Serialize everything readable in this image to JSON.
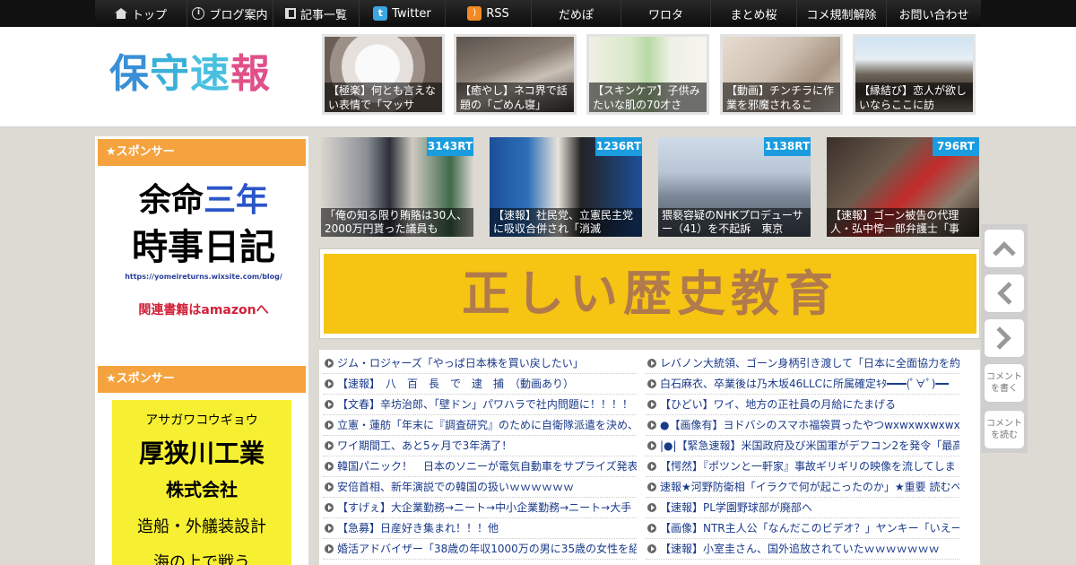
{
  "nav": {
    "items": [
      {
        "label": "トップ",
        "icon": "home-icon"
      },
      {
        "label": "ブログ案内",
        "icon": "info-icon"
      },
      {
        "label": "記事一覧",
        "icon": "list-icon"
      },
      {
        "label": "Twitter",
        "icon": "twitter-icon"
      },
      {
        "label": "RSS",
        "icon": "rss-icon"
      },
      {
        "label": "だめぽ"
      },
      {
        "label": "ワロタ"
      },
      {
        "label": "まとめ桜"
      },
      {
        "label": "コメ規制解除"
      },
      {
        "label": "お問い合わせ"
      }
    ]
  },
  "header": {
    "logo_text": "保守速報",
    "thumbs": [
      {
        "caption": "【極楽】何とも言えない表情で「マッサ"
      },
      {
        "caption": "【癒やし】ネコ界で話題の「ごめん寝」"
      },
      {
        "caption": "【スキンケア】子供みたいな肌の70才さ"
      },
      {
        "caption": "【動画】チンチラに作業を邪魔されるこ"
      },
      {
        "caption": "【縁結び】恋人が欲しいならここに訪"
      }
    ]
  },
  "sidebar": {
    "sponsor_label_1": "★スポンサー",
    "ad1": {
      "line1a": "余命",
      "line1b": "三年",
      "line2": "時事日記",
      "url": "https://yomeireturns.wixsite.com/blog/",
      "link": "関連書籍はamazonへ"
    },
    "sponsor_label_2": "★スポンサー",
    "ad2": {
      "kana": "アサガワコウギョウ",
      "name": "厚狭川工業",
      "corp": "株式会社",
      "desc": "造船・外艤装設計",
      "more": "海の上で戦う"
    }
  },
  "cards": [
    {
      "rt": "3143RT",
      "caption": "「俺の知る限り賄賂は30人、2000万円貰った議員も"
    },
    {
      "rt": "1236RT",
      "caption": "【速報】社民党、立憲民主党に吸収合併され「消滅"
    },
    {
      "rt": "1138RT",
      "caption": "猥褻容疑のNHKプロデューサー（41）を不起訴　東京"
    },
    {
      "rt": "796RT",
      "caption": "【速報】ゴーン被告の代理人・弘中惇一郎弁護士「事"
    }
  ],
  "banner": {
    "text": "正しい歴史教育"
  },
  "list": {
    "left": [
      "ジム・ロジャーズ「やっぱ日本株を買い戻したい」",
      "【速報】　八　百　長　で　逮　捕　（動画あり）",
      "【文春】辛坊治郎、「壁ドン」パワハラで社内問題に！！！！",
      "立憲・蓮舫「年末に『調査研究』のために自衛隊派遣を決め、",
      "ワイ期間工、あと5ヶ月で3年満了！",
      "韓国パニック！　日本のソニーが電気自動車をサプライズ発表",
      "安倍首相、新年演説での韓国の扱いｗｗｗｗｗｗ",
      "【すげぇ】大企業勤務→ニート→中小企業勤務→ニート→大手",
      "【急募】日産好き集まれ！！！他",
      "婚活アドバイザー「38歳の年収1000万の男に35歳の女性を紹介"
    ],
    "right": [
      "レバノン大統領、ゴーン身柄引き渡して「日本に全面協力を約",
      "白石麻衣、卒業後は乃木坂46LLCに所属確定ｷﾀ━━━(ﾟ∀ﾟ)━━",
      "【ひどい】ワイ、地方の正社員の月給にたまげる",
      "●【画像有】ヨドバシのスマホ福袋買ったやつwxwxwxwxwxw",
      "|●|【緊急速報】米国政府及び米国軍がデフコン2を発令「最高度",
      "【愕然】『ポツンと一軒家』事故ギリギリの映像を流してしま",
      "速報★河野防衛相「イラクで何が起こったのか」★重要 読むべ",
      "【速報】PL学園野球部が廃部へ",
      "【画像】NTR主人公「なんだこのビデオ？」ヤンキー「いえー",
      "【速報】小室圭さん、国外追放されていたｗｗｗｗｗｗｗ"
    ]
  },
  "rightnav": {
    "comment_write": "コメントを書く",
    "comment_read": "コメントを読む"
  },
  "colors": {
    "accent": "#f5a33e",
    "rt_badge": "#1a9cde",
    "link": "#1a3a8a",
    "banner_bg": "#f6c412"
  }
}
